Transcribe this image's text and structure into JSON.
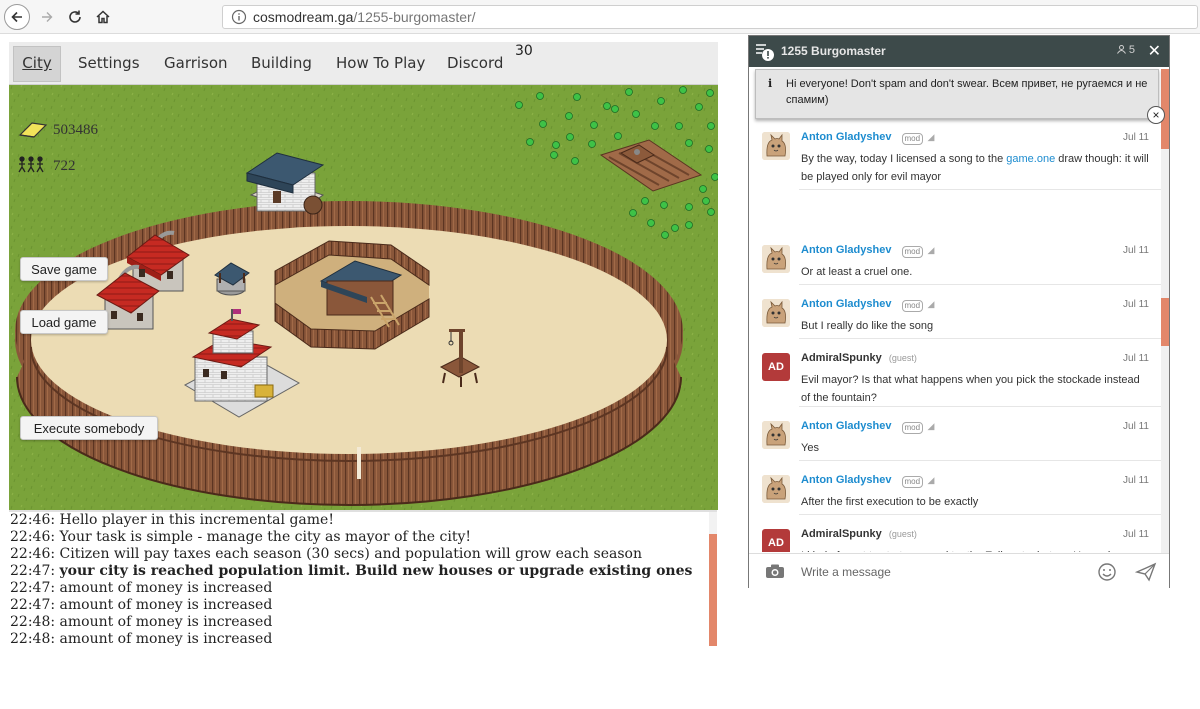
{
  "browser": {
    "url_domain": "cosmodream.ga",
    "url_path": "/1255-burgomaster/"
  },
  "menu": {
    "items": [
      "City",
      "Settings",
      "Garrison",
      "Building",
      "How To Play",
      "Discord"
    ],
    "season_counter": "30"
  },
  "hud": {
    "money": "503486",
    "population": "722"
  },
  "buttons": {
    "save": "Save game",
    "load": "Load game",
    "execute": "Execute somebody"
  },
  "log": [
    {
      "time": "22:46:",
      "text": "Hello player in this incremental game!",
      "bold": false
    },
    {
      "time": "22:46:",
      "text": "Your task is simple - manage the city as mayor of the city!",
      "bold": false
    },
    {
      "time": "22:46:",
      "text": "Citizen will pay taxes each season (30 secs) and population will grow each season",
      "bold": false
    },
    {
      "time": "22:47:",
      "text": "your city is reached population limit. Build new houses or upgrade existing ones",
      "bold": true
    },
    {
      "time": "22:47:",
      "text": "amount of money is increased",
      "bold": false
    },
    {
      "time": "22:47:",
      "text": "amount of money is increased",
      "bold": false
    },
    {
      "time": "22:48:",
      "text": "amount of money is increased",
      "bold": false
    },
    {
      "time": "22:48:",
      "text": "amount of money is increased",
      "bold": false
    }
  ],
  "chat": {
    "title": "1255 Burgomaster",
    "user_count": "5",
    "announcement": "Hi everyone! Don't spam and don't swear. Всем привет, не ругаемся и не спамим)",
    "input_placeholder": "Write a message",
    "messages": [
      {
        "author": "Anton Gladyshev",
        "role": "mod",
        "date": "Jul 11",
        "avatar": "cat",
        "text_before": "By the way, today I licensed a song to the ",
        "link": "game.one",
        "text_after": " draw though: it will be played only for evil mayor"
      },
      {
        "author": "Anton Gladyshev",
        "role": "mod",
        "date": "Jul 11",
        "avatar": "cat",
        "text_before": "Or at least a cruel one.",
        "link": "",
        "text_after": ""
      },
      {
        "author": "Anton Gladyshev",
        "role": "mod",
        "date": "Jul 11",
        "avatar": "cat",
        "text_before": "But I really do like the song",
        "link": "",
        "text_after": ""
      },
      {
        "author": "AdmiralSpunky",
        "role": "guest",
        "date": "Jul 11",
        "avatar": "AD",
        "text_before": "Evil mayor? Is that what happens when you pick the stockade instead of the fountain?",
        "link": "",
        "text_after": ""
      },
      {
        "author": "Anton Gladyshev",
        "role": "mod",
        "date": "Jul 11",
        "avatar": "cat",
        "text_before": "Yes",
        "link": "",
        "text_after": ""
      },
      {
        "author": "Anton Gladyshev",
        "role": "mod",
        "date": "Jul 11",
        "avatar": "cat",
        "text_before": "After the first execution to be exactly",
        "link": "",
        "text_after": ""
      },
      {
        "author": "AdmiralSpunky",
        "role": "guest",
        "date": "Jul 11",
        "avatar": "AD",
        "text_before": "I kind of want to start over and try the Evil route, but my House is already at level 22 - I feel like I'm committed to the path that I'm on.",
        "link": "",
        "text_after": ""
      }
    ]
  },
  "colors": {
    "grass": "#7aa33a",
    "sand": "#ecdcb4",
    "wood": "#7a4a30",
    "accent": "#e3876a",
    "link": "#1d8ccf",
    "chat_header": "#3d4a4a"
  }
}
